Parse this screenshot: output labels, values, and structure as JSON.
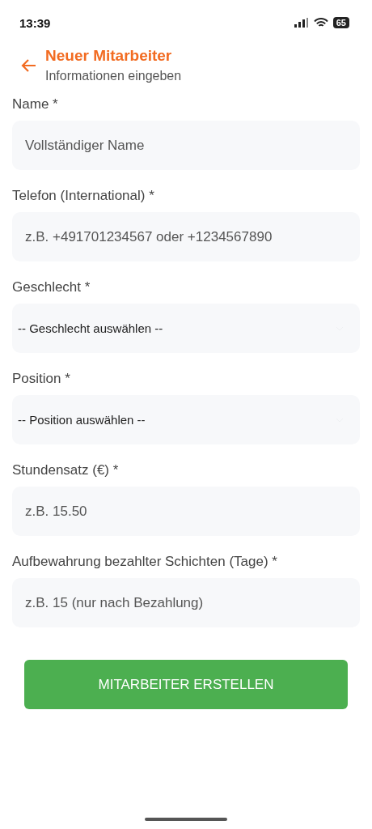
{
  "status_bar": {
    "time": "13:39",
    "battery": "65"
  },
  "header": {
    "title": "Neuer Mitarbeiter",
    "subtitle": "Informationen eingeben"
  },
  "fields": [
    {
      "kind": "input",
      "label": "Name *",
      "placeholder": "Vollständiger Name"
    },
    {
      "kind": "input",
      "label": "Telefon (International) *",
      "placeholder": "z.B. +491701234567 oder +1234567890"
    },
    {
      "kind": "select",
      "label": "Geschlecht *",
      "value": "-- Geschlecht auswählen --"
    },
    {
      "kind": "select",
      "label": "Position *",
      "value": "-- Position auswählen --"
    },
    {
      "kind": "input",
      "label": "Stundensatz (€) *",
      "placeholder": "z.B. 15.50"
    },
    {
      "kind": "input",
      "label": "Aufbewahrung bezahlter Schichten (Tage) *",
      "placeholder": "z.B. 15 (nur nach Bezahlung)"
    }
  ],
  "submit": {
    "label": "MITARBEITER ERSTELLEN"
  }
}
